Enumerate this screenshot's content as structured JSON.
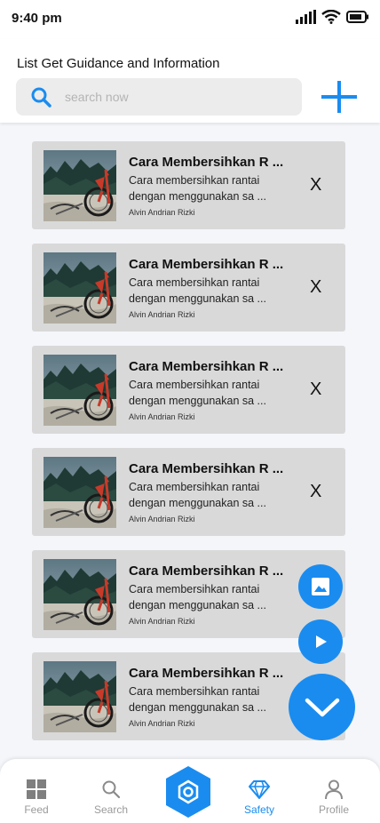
{
  "status_bar": {
    "time": "9:40 pm"
  },
  "header": {
    "title": "List Get Guidance and Information",
    "search_placeholder": "search now",
    "search_value": ""
  },
  "items": [
    {
      "title": "Cara Membersihkan R ...",
      "desc_line1": "Cara membersihkan rantai",
      "desc_line2": "dengan menggunakan sa ...",
      "author": "Alvin Andrian Rizki",
      "delete_label": "X"
    },
    {
      "title": "Cara Membersihkan R ...",
      "desc_line1": "Cara membersihkan rantai",
      "desc_line2": "dengan menggunakan sa ...",
      "author": "Alvin Andrian Rizki",
      "delete_label": "X"
    },
    {
      "title": "Cara Membersihkan R ...",
      "desc_line1": "Cara membersihkan rantai",
      "desc_line2": "dengan menggunakan sa ...",
      "author": "Alvin Andrian Rizki",
      "delete_label": "X"
    },
    {
      "title": "Cara Membersihkan R ...",
      "desc_line1": "Cara membersihkan rantai",
      "desc_line2": "dengan menggunakan sa ...",
      "author": "Alvin Andrian Rizki",
      "delete_label": "X"
    },
    {
      "title": "Cara Membersihkan R ...",
      "desc_line1": "Cara membersihkan rantai",
      "desc_line2": "dengan menggunakan sa ...",
      "author": "Alvin Andrian Rizki"
    },
    {
      "title": "Cara Membersihkan R ...",
      "desc_line1": "Cara membersihkan rantai",
      "desc_line2": "dengan menggunakan sa ...",
      "author": "Alvin Andrian Rizki"
    }
  ],
  "fabs": {
    "image_icon": "image-icon",
    "play_icon": "play-icon",
    "collapse_icon": "chevron-down-icon"
  },
  "bottom_nav": {
    "feed": "Feed",
    "search": "Search",
    "center_icon": "hexagon-icon",
    "safety": "Safety",
    "profile": "Profile",
    "active": "Safety"
  },
  "colors": {
    "accent": "#1a8cf0",
    "card_bg": "#d9d9d9",
    "search_bg": "#ececec",
    "page_bg": "#f4f6fa"
  }
}
